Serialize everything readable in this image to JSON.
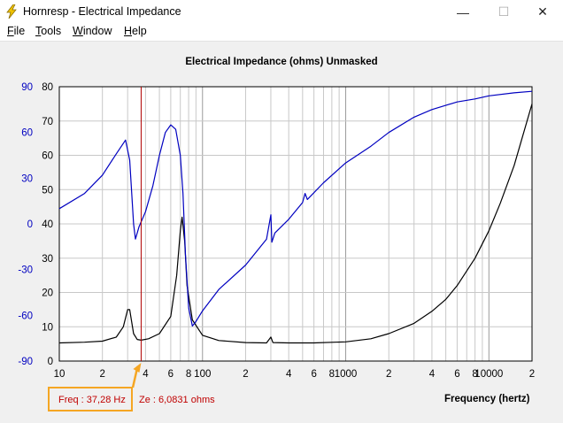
{
  "window": {
    "title": "Hornresp - Electrical Impedance",
    "minimize": "—",
    "maximize": "☐",
    "close": "✕",
    "icon": "lightning-bolt-icon"
  },
  "menu": {
    "items": [
      {
        "label": "File",
        "accel": "F",
        "rest": "ile"
      },
      {
        "label": "Tools",
        "accel": "T",
        "rest": "ools"
      },
      {
        "label": "Window",
        "accel": "W",
        "rest": "indow"
      },
      {
        "label": "Help",
        "accel": "H",
        "rest": "elp"
      }
    ]
  },
  "chart": {
    "title": "Electrical Impedance (ohms)   Unmasked",
    "x_axis_title": "Frequency (hertz)",
    "status_freq": "Freq : 37,28 Hz",
    "status_ze": "Ze : 6,0831 ohms"
  },
  "colors": {
    "impedance": "#000000",
    "phase": "#0000c0",
    "cursor": "#b00000",
    "highlight": "#f5a623",
    "grid": "#c8c8c8"
  },
  "chart_data": {
    "type": "line",
    "x_scale": "log",
    "xlim": [
      10,
      20000
    ],
    "ylim_left": [
      0,
      80
    ],
    "ylim_right": [
      -90,
      90
    ],
    "left_ticks": [
      "0",
      "10",
      "20",
      "30",
      "40",
      "50",
      "60",
      "70",
      "80"
    ],
    "right_ticks": [
      "-90",
      "-60",
      "-30",
      "0",
      "30",
      "60",
      "90"
    ],
    "x_ticks": [
      {
        "x": 10,
        "label": "10"
      },
      {
        "x": 20,
        "label": "2"
      },
      {
        "x": 40,
        "label": "4"
      },
      {
        "x": 60,
        "label": "6"
      },
      {
        "x": 80,
        "label": "8"
      },
      {
        "x": 100,
        "label": "100"
      },
      {
        "x": 200,
        "label": "2"
      },
      {
        "x": 400,
        "label": "4"
      },
      {
        "x": 600,
        "label": "6"
      },
      {
        "x": 800,
        "label": "8"
      },
      {
        "x": 1000,
        "label": "1000"
      },
      {
        "x": 2000,
        "label": "2"
      },
      {
        "x": 4000,
        "label": "4"
      },
      {
        "x": 6000,
        "label": "6"
      },
      {
        "x": 8000,
        "label": "8"
      },
      {
        "x": 10000,
        "label": "10000"
      },
      {
        "x": 20000,
        "label": "2"
      }
    ],
    "cursor_freq": 37.28,
    "series": [
      {
        "axis": "left",
        "color": "#000000",
        "points": [
          [
            10,
            5.3
          ],
          [
            15,
            5.5
          ],
          [
            20,
            5.8
          ],
          [
            25,
            7
          ],
          [
            28,
            10
          ],
          [
            30,
            15
          ],
          [
            31,
            15
          ],
          [
            33,
            8
          ],
          [
            35,
            6.3
          ],
          [
            37.28,
            6.08
          ],
          [
            42,
            6.5
          ],
          [
            50,
            8
          ],
          [
            60,
            13
          ],
          [
            66,
            25
          ],
          [
            70,
            38
          ],
          [
            72,
            42
          ],
          [
            75,
            35
          ],
          [
            78,
            22
          ],
          [
            85,
            12
          ],
          [
            100,
            7.5
          ],
          [
            130,
            6
          ],
          [
            200,
            5.4
          ],
          [
            280,
            5.3
          ],
          [
            300,
            7
          ],
          [
            310,
            5.4
          ],
          [
            400,
            5.3
          ],
          [
            600,
            5.3
          ],
          [
            1000,
            5.6
          ],
          [
            1500,
            6.5
          ],
          [
            2000,
            8
          ],
          [
            3000,
            11
          ],
          [
            4000,
            14.5
          ],
          [
            5000,
            18
          ],
          [
            6000,
            22
          ],
          [
            8000,
            30
          ],
          [
            10000,
            38
          ],
          [
            12000,
            46
          ],
          [
            15000,
            57
          ],
          [
            20000,
            75
          ]
        ]
      },
      {
        "axis": "right",
        "color": "#0000c0",
        "points": [
          [
            10,
            10
          ],
          [
            15,
            20
          ],
          [
            20,
            32
          ],
          [
            25,
            46
          ],
          [
            29,
            55
          ],
          [
            31,
            42
          ],
          [
            33,
            0
          ],
          [
            34,
            -10
          ],
          [
            36,
            -2
          ],
          [
            40,
            8
          ],
          [
            45,
            25
          ],
          [
            50,
            45
          ],
          [
            55,
            60
          ],
          [
            60,
            65
          ],
          [
            65,
            62
          ],
          [
            70,
            45
          ],
          [
            73,
            20
          ],
          [
            76,
            -20
          ],
          [
            80,
            -55
          ],
          [
            85,
            -67
          ],
          [
            90,
            -64
          ],
          [
            100,
            -57
          ],
          [
            130,
            -43
          ],
          [
            200,
            -27
          ],
          [
            280,
            -10
          ],
          [
            300,
            6
          ],
          [
            305,
            -12
          ],
          [
            320,
            -6
          ],
          [
            400,
            3
          ],
          [
            500,
            14
          ],
          [
            520,
            20
          ],
          [
            540,
            16
          ],
          [
            700,
            27
          ],
          [
            1000,
            40
          ],
          [
            1500,
            51
          ],
          [
            2000,
            60
          ],
          [
            3000,
            70
          ],
          [
            4000,
            75
          ],
          [
            6000,
            80
          ],
          [
            8000,
            82
          ],
          [
            10000,
            84
          ],
          [
            15000,
            86
          ],
          [
            20000,
            87
          ]
        ]
      }
    ]
  }
}
